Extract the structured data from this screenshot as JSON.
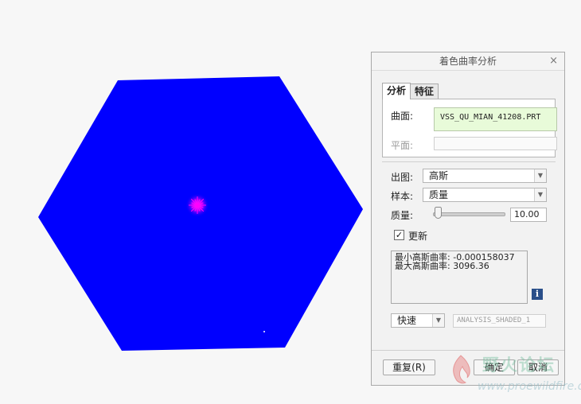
{
  "dialog": {
    "title": "着色曲率分析",
    "close_glyph": "×",
    "tabs": [
      {
        "label": "分析",
        "active": true
      },
      {
        "label": "特征",
        "active": false
      }
    ],
    "surface_label": "曲面:",
    "surface_value": "VSS_QU_MIAN_41208.PRT",
    "plane_label": "平面:",
    "plane_value": "",
    "output_label": "出图:",
    "output_value": "高斯",
    "sample_label": "样本:",
    "sample_value": "质量",
    "quality_label": "质量:",
    "quality_value": "10.00",
    "quality_slider_fraction": 0.07,
    "update_label": "更新",
    "update_checked": true,
    "results": {
      "min_label": "最小高斯曲率:",
      "min_value": "-0.000158037",
      "max_label": "最大高斯曲率:",
      "max_value": "3096.36"
    },
    "info_glyph": "i",
    "mode_value": "快速",
    "analysis_name": "ANALYSIS_SHADED_1",
    "reset_label": "重复(R)",
    "ok_label": "确定",
    "cancel_label": "取消"
  },
  "viewport": {
    "shape_color": "#0000ff",
    "highlight_color": "#ff00ff"
  },
  "watermark": {
    "title": "野火论坛",
    "url": "www.proewildfire.cn"
  }
}
